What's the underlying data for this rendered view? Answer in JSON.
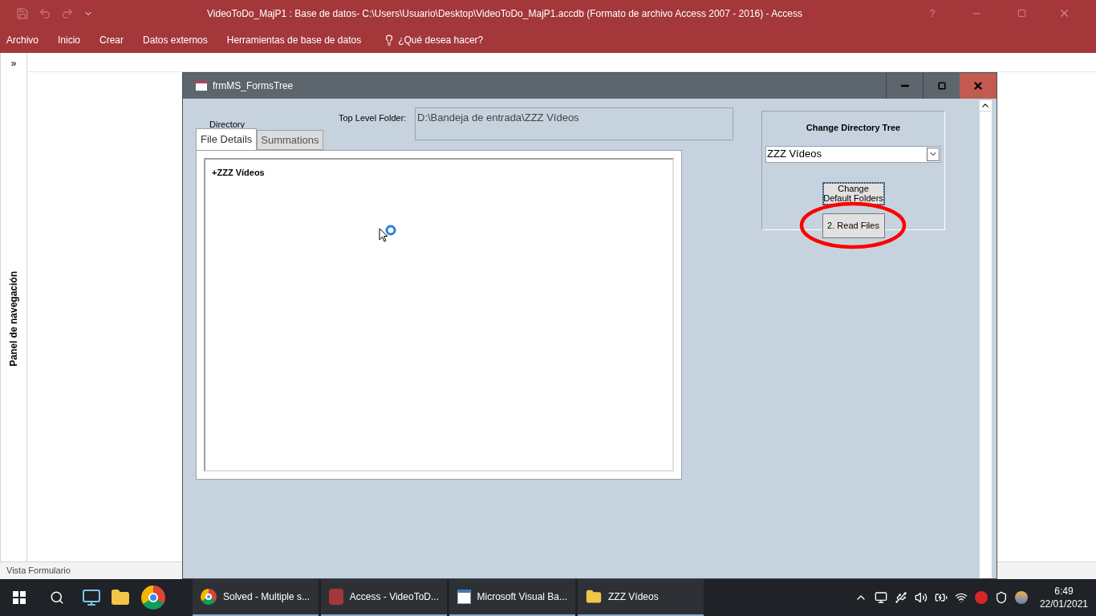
{
  "window": {
    "title": "VideoToDo_MajP1 : Base de datos- C:\\Users\\Usuario\\Desktop\\VideoToDo_MajP1.accdb (Formato de archivo Access 2007 - 2016) - Access",
    "help": "?"
  },
  "ribbon_tabs": [
    "Archivo",
    "Inicio",
    "Crear",
    "Datos externos",
    "Herramientas de base de datos"
  ],
  "tell_me": "¿Qué desea hacer?",
  "nav_pane": {
    "toggle": "»",
    "title": "Panel de navegación"
  },
  "form": {
    "title": "frmMS_FormsTree",
    "directory_label": "Directory",
    "top_level_label": "Top Level Folder:",
    "top_level_value": "D:\\Bandeja de entrada\\ZZZ Vídeos",
    "tabs": [
      {
        "label": "File Details",
        "selected": true
      },
      {
        "label": "Summations",
        "selected": false
      }
    ],
    "tree": [
      {
        "expander": "+",
        "label": "ZZZ Vídeos"
      }
    ],
    "side_panel": {
      "title": "Change Directory Tree",
      "combo_value": "ZZZ Vídeos",
      "buttons": [
        {
          "label": "Change Default Folders",
          "focused": true
        },
        {
          "label": "2. Read Files",
          "focused": false
        }
      ]
    }
  },
  "status_bar": "Vista Formulario",
  "taskbar": {
    "windows": [
      {
        "kind": "chrome",
        "label": "Solved - Multiple s..."
      },
      {
        "kind": "access",
        "label": "Access - VideoToD..."
      },
      {
        "kind": "vba",
        "label": "Microsoft Visual Ba..."
      },
      {
        "kind": "folder",
        "label": "ZZZ Vídeos"
      }
    ],
    "time": "6:49",
    "date": "22/01/2021"
  }
}
